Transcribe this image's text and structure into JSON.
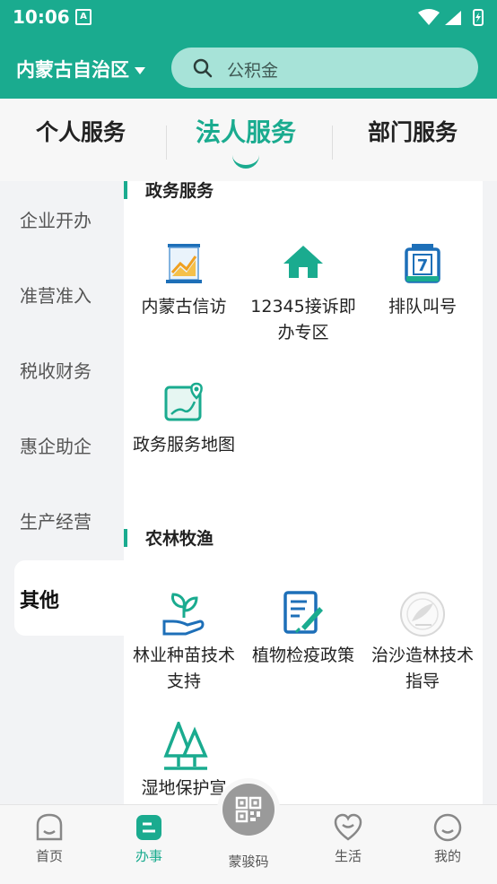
{
  "status_bar": {
    "time": "10:06",
    "notification_icon": "A"
  },
  "header": {
    "region": "内蒙古自治区",
    "search_placeholder": "公积金"
  },
  "tabs": [
    {
      "label": "个人服务",
      "active": false
    },
    {
      "label": "法人服务",
      "active": true
    },
    {
      "label": "部门服务",
      "active": false
    }
  ],
  "sidebar": {
    "items": [
      "企业开办",
      "准营准入",
      "税收财务",
      "惠企助企",
      "生产经营",
      "其他"
    ],
    "active": "其他"
  },
  "sections": [
    {
      "title": "政务服务",
      "services": [
        {
          "label": "内蒙古信访",
          "icon": "chart-board-icon"
        },
        {
          "label": "12345接诉即办专区",
          "icon": "house-icon"
        },
        {
          "label": "排队叫号",
          "icon": "calendar-number-icon"
        },
        {
          "label": "政务服务地图",
          "icon": "map-pin-icon"
        }
      ]
    },
    {
      "title": "农林牧渔",
      "services": [
        {
          "label": "林业种苗技术支持",
          "icon": "seedling-hand-icon"
        },
        {
          "label": "植物检疫政策",
          "icon": "document-syringe-icon"
        },
        {
          "label": "治沙造林技术指导",
          "icon": "emblem-seal-icon"
        },
        {
          "label": "湿地保护宣",
          "icon": "trees-icon"
        }
      ]
    }
  ],
  "bottom_nav": [
    {
      "label": "首页",
      "icon": "home-face-icon",
      "active": false
    },
    {
      "label": "办事",
      "icon": "task-icon",
      "active": true
    },
    {
      "label": "蒙骏码",
      "icon": "qr-code-icon",
      "active": false
    },
    {
      "label": "生活",
      "icon": "heart-icon",
      "active": false
    },
    {
      "label": "我的",
      "icon": "profile-face-icon",
      "active": false
    }
  ],
  "colors": {
    "accent": "#1aab8f",
    "header_bg": "#1aab8f",
    "icon_blue": "#1d6fb8",
    "icon_green": "#1aab8f"
  }
}
